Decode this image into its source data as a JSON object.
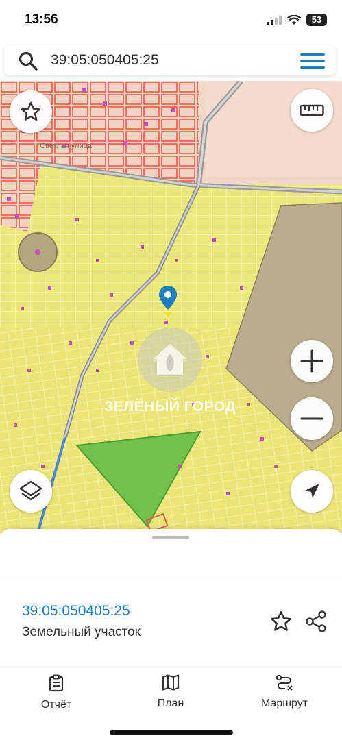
{
  "status_bar": {
    "time": "13:56",
    "battery": "53"
  },
  "search": {
    "query": "39:05:050405:25"
  },
  "map": {
    "street_label": "Светлая улица",
    "watermark": "ЗЕЛЁНЫЙ ГОРОД",
    "controls": [
      "favorite-star",
      "ruler",
      "zoom-in",
      "zoom-out",
      "layers",
      "my-location"
    ],
    "colors": {
      "parcel_fill": "#ece77a",
      "built_zone": "#f2d2c0",
      "lot_outline": "#e85a4a",
      "selected_area": "#6fc24a",
      "large_parcel": "#b9ad8e",
      "road": "#9a9a9a",
      "river": "#4a86d8",
      "pin": "#1f7ec1"
    }
  },
  "sheet": {
    "cadastral_number": "39:05:050405:25",
    "object_type": "Земельный участок"
  },
  "nav": {
    "report": "Отчёт",
    "plan": "План",
    "route": "Маршрут"
  }
}
